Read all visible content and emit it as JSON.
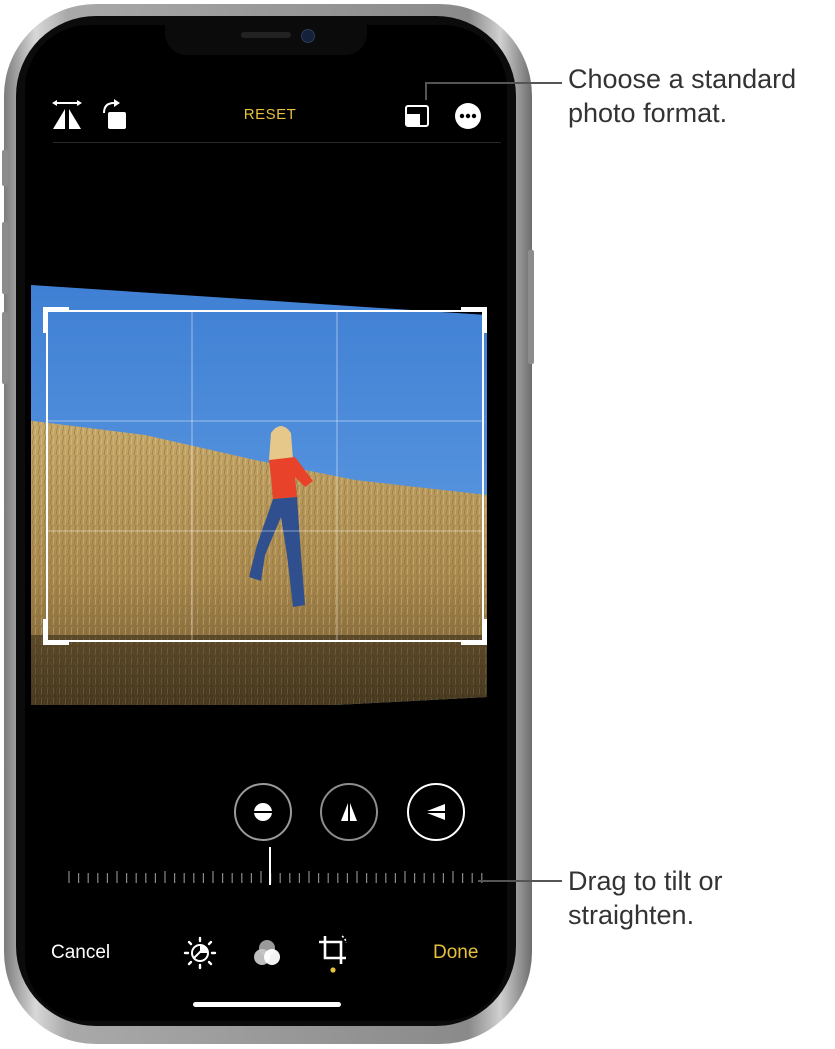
{
  "toolbar": {
    "reset_label": "RESET",
    "icons": [
      "flip-icon",
      "rotate-icon",
      "aspect-ratio-icon",
      "more-icon"
    ]
  },
  "adjustments": {
    "buttons": [
      "straighten",
      "vertical-perspective",
      "horizontal-perspective"
    ]
  },
  "bottom_bar": {
    "cancel_label": "Cancel",
    "done_label": "Done",
    "tool_icons": [
      "adjust-icon",
      "filters-icon",
      "crop-icon"
    ],
    "active_tool": "crop"
  },
  "callouts": {
    "format": "Choose a standard\nphoto format.",
    "tilt": "Drag to tilt or\nstraighten."
  },
  "colors": {
    "accent": "#e7c13b",
    "sky": "#4a88d8",
    "shirt": "#e8432a"
  }
}
